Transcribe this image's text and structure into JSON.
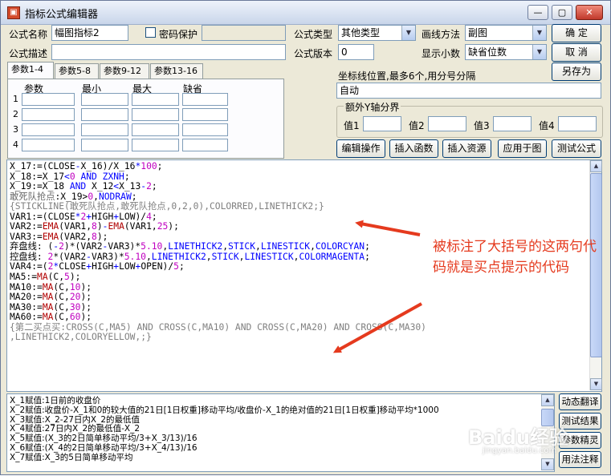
{
  "window": {
    "title": "指标公式编辑器",
    "min": "—",
    "max": "▢",
    "close": "✕"
  },
  "form": {
    "name_label": "公式名称",
    "name_value": "幅图指标2",
    "password_label": "密码保护",
    "desc_label": "公式描述",
    "desc_value": "",
    "type_label": "公式类型",
    "type_value": "其他类型",
    "draw_label": "画线方法",
    "draw_value": "副图",
    "version_label": "公式版本",
    "version_value": "0",
    "decimal_label": "显示小数",
    "decimal_value": "缺省位数"
  },
  "buttons": {
    "ok": "确 定",
    "cancel": "取 消",
    "save_as": "另存为",
    "edit_op": "编辑操作",
    "insert_func": "插入函数",
    "insert_res": "插入资源",
    "apply_chart": "应用于图",
    "test_formula": "测试公式"
  },
  "tabs": [
    "参数1-4",
    "参数5-8",
    "参数9-12",
    "参数13-16"
  ],
  "params": {
    "headers": [
      "参数",
      "最小",
      "最大",
      "缺省"
    ],
    "rows": [
      "1",
      "2",
      "3",
      "4"
    ]
  },
  "ycoord": {
    "label": "坐标线位置,最多6个,用分号分隔",
    "value": "自动"
  },
  "yaxis": {
    "title": "额外Y轴分界",
    "labels": [
      "值1",
      "值2",
      "值3",
      "值4"
    ]
  },
  "code_lines": [
    [
      [
        "k",
        "X_17:=("
      ],
      [
        "k",
        "CLOSE"
      ],
      [
        "op",
        "-"
      ],
      [
        "k",
        "X_16)/X_16"
      ],
      [
        "op",
        "*"
      ],
      [
        "num",
        "100"
      ],
      [
        "k",
        ";"
      ]
    ],
    [
      [
        "k",
        "X_18:=X_17"
      ],
      [
        "op",
        "<"
      ],
      [
        "num",
        "0"
      ],
      [
        "kw",
        " AND "
      ],
      [
        "kw",
        "ZXNH"
      ],
      [
        "k",
        ";"
      ]
    ],
    [
      [
        "k",
        "X_19:=X_18 "
      ],
      [
        "kw",
        "AND"
      ],
      [
        "k",
        " X_12"
      ],
      [
        "op",
        "<"
      ],
      [
        "k",
        "X_13"
      ],
      [
        "op",
        "-"
      ],
      [
        "num",
        "2"
      ],
      [
        "k",
        ";"
      ]
    ],
    [
      [
        "gr",
        "敢死队抢点"
      ],
      [
        "k",
        ":X_19>"
      ],
      [
        "num",
        "0"
      ],
      [
        "k",
        ","
      ],
      [
        "kw",
        "NODRAW"
      ],
      [
        "k",
        ";"
      ]
    ],
    [
      [
        "cm",
        "{STICKLINE(敢死队抢点,敢死队抢点,0,2,0),COLORRED,LINETHICK2;}"
      ]
    ],
    [
      [
        "k",
        "VAR1:=("
      ],
      [
        "k",
        "CLOSE"
      ],
      [
        "op",
        "*"
      ],
      [
        "num",
        "2"
      ],
      [
        "op",
        "+"
      ],
      [
        "k",
        "HIGH"
      ],
      [
        "op",
        "+"
      ],
      [
        "k",
        "LOW)/"
      ],
      [
        "num",
        "4"
      ],
      [
        "k",
        ";"
      ]
    ],
    [
      [
        "k",
        "VAR2:="
      ],
      [
        "fn",
        "EMA"
      ],
      [
        "k",
        "(VAR1,"
      ],
      [
        "num",
        "8"
      ],
      [
        "k",
        ")"
      ],
      [
        "op",
        "-"
      ],
      [
        "fn",
        "EMA"
      ],
      [
        "k",
        "(VAR1,"
      ],
      [
        "num",
        "25"
      ],
      [
        "k",
        ");"
      ]
    ],
    [
      [
        "k",
        "VAR3:="
      ],
      [
        "fn",
        "EMA"
      ],
      [
        "k",
        "(VAR2,"
      ],
      [
        "num",
        "8"
      ],
      [
        "k",
        ");"
      ]
    ],
    [
      [
        "k",
        "弃盘线: ("
      ],
      [
        "op",
        "-"
      ],
      [
        "num",
        "2"
      ],
      [
        "k",
        ")*(VAR2"
      ],
      [
        "op",
        "-"
      ],
      [
        "k",
        "VAR3)*"
      ],
      [
        "num",
        "5.10"
      ],
      [
        "k",
        ","
      ],
      [
        "kw",
        "LINETHICK2"
      ],
      [
        "k",
        ","
      ],
      [
        "kw",
        "STICK"
      ],
      [
        "k",
        ","
      ],
      [
        "kw",
        "LINESTICK"
      ],
      [
        "k",
        ","
      ],
      [
        "kw",
        "COLORCYAN"
      ],
      [
        "k",
        ";"
      ]
    ],
    [
      [
        "k",
        "控盘线: "
      ],
      [
        "num",
        "2"
      ],
      [
        "k",
        "*(VAR2"
      ],
      [
        "op",
        "-"
      ],
      [
        "k",
        "VAR3)*"
      ],
      [
        "num",
        "5.10"
      ],
      [
        "k",
        ","
      ],
      [
        "kw",
        "LINETHICK2"
      ],
      [
        "k",
        ","
      ],
      [
        "kw",
        "STICK"
      ],
      [
        "k",
        ","
      ],
      [
        "kw",
        "LINESTICK"
      ],
      [
        "k",
        ","
      ],
      [
        "kw",
        "COLORMAGENTA"
      ],
      [
        "k",
        ";"
      ]
    ],
    [
      [
        "k",
        "VAR4:=("
      ],
      [
        "num",
        "2"
      ],
      [
        "op",
        "*"
      ],
      [
        "k",
        "CLOSE"
      ],
      [
        "op",
        "+"
      ],
      [
        "k",
        "HIGH"
      ],
      [
        "op",
        "+"
      ],
      [
        "k",
        "LOW"
      ],
      [
        "op",
        "+"
      ],
      [
        "k",
        "OPEN)/"
      ],
      [
        "num",
        "5"
      ],
      [
        "k",
        ";"
      ]
    ],
    [
      [
        "k",
        "MA5:="
      ],
      [
        "fn",
        "MA"
      ],
      [
        "k",
        "(C,"
      ],
      [
        "num",
        "5"
      ],
      [
        "k",
        ");"
      ]
    ],
    [
      [
        "k",
        "MA10:="
      ],
      [
        "fn",
        "MA"
      ],
      [
        "k",
        "(C,"
      ],
      [
        "num",
        "10"
      ],
      [
        "k",
        ");"
      ]
    ],
    [
      [
        "k",
        "MA20:="
      ],
      [
        "fn",
        "MA"
      ],
      [
        "k",
        "(C,"
      ],
      [
        "num",
        "20"
      ],
      [
        "k",
        ");"
      ]
    ],
    [
      [
        "k",
        "MA30:="
      ],
      [
        "fn",
        "MA"
      ],
      [
        "k",
        "(C,"
      ],
      [
        "num",
        "30"
      ],
      [
        "k",
        ");"
      ]
    ],
    [
      [
        "k",
        "MA60:="
      ],
      [
        "fn",
        "MA"
      ],
      [
        "k",
        "(C,"
      ],
      [
        "num",
        "60"
      ],
      [
        "k",
        ");"
      ]
    ],
    [
      [
        "cm",
        "{第二买点买:CROSS(C,MA5) AND CROSS(C,MA10) AND CROSS(C,MA20) AND CROSS(C,MA30)"
      ]
    ],
    [
      [
        "cm",
        ",LINETHICK2,COLORYELLOW,;}"
      ]
    ]
  ],
  "notes": [
    "X_1赋值:1日前的收盘价",
    "X_2赋值:收盘价-X_1和0的较大值的21日[1日权重]移动平均/收盘价-X_1的绝对值的21日[1日权重]移动平均*1000",
    "X_3赋值:X_2-27日内X_2的最低值",
    "X_4赋值:27日内X_2的最低值-X_2",
    "X_5赋值:(X_3的2日简单移动平均/3+X_3/13)/16",
    "X_6赋值:(X_4的2日简单移动平均/3+X_4/13)/16",
    "X_7赋值:X_3的5日简单移动平均"
  ],
  "side_buttons": [
    "动态翻译",
    "测试结果",
    "参数精灵",
    "用法注释"
  ],
  "annotation": "被标注了大括号的这两句代码就是买点提示的代码",
  "watermark": "Baidu经验",
  "watermark_url": "jingyan.baidu.com",
  "colors": {
    "arrow": "#e53a1e",
    "keyword": "#0000ff",
    "function": "#b00000",
    "number": "#c000c0"
  }
}
